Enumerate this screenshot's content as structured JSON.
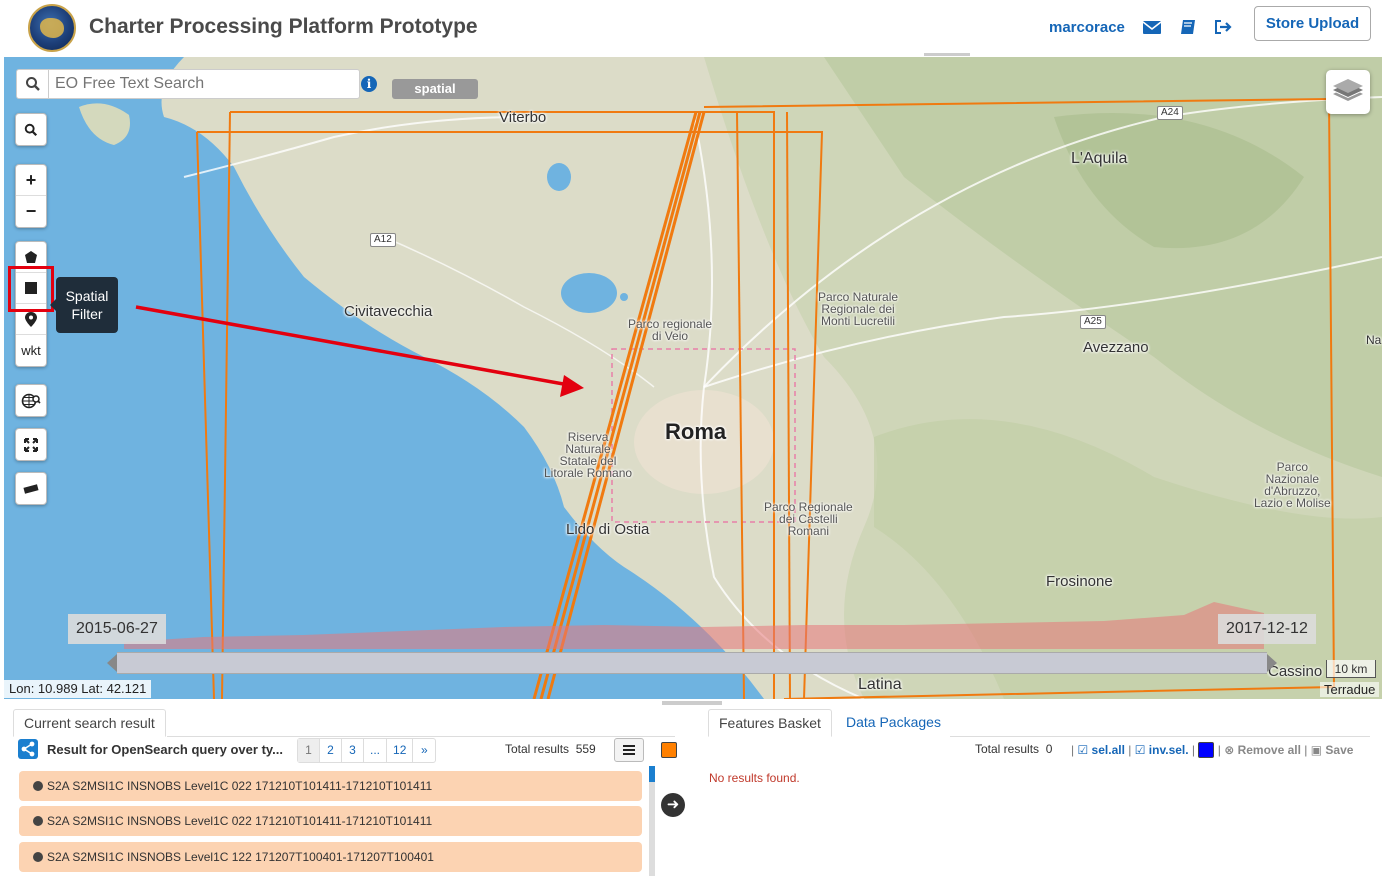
{
  "header": {
    "title": "Charter Processing Platform Prototype",
    "user": "marcorace",
    "store_upload": "Store Upload",
    "icons": [
      "envelope-icon",
      "book-icon",
      "sign-out-icon"
    ]
  },
  "map": {
    "search_placeholder": "EO Free Text Search",
    "mode_badge": "spatial",
    "tooltip": "Spatial Filter",
    "wkt_label": "wkt",
    "places": {
      "viterbo": "Viterbo",
      "civitavecchia": "Civitavecchia",
      "roma": "Roma",
      "laquila": "L'Aquila",
      "avezzano": "Avezzano",
      "frosinone": "Frosinone",
      "latina": "Latina",
      "cassino": "Cassino",
      "lido": "Lido di Ostia"
    },
    "parks": {
      "veio": "Parco regionale\ndi Veio",
      "lucretili": "Parco Naturale\nRegionale dei\nMonti Lucretili",
      "litorale": "Riserva\nNaturale\nStatale del\nLitorale Romano",
      "castelli": "Parco Regionale\ndei Castelli\nRomani",
      "abruzzo": "Parco\nNazionale\nd'Abruzzo,\nLazio e Molise"
    },
    "roads": {
      "a12": "A12",
      "a24": "A24",
      "a25": "A25"
    },
    "edge_label": "Na",
    "timeline": {
      "start": "2015-06-27",
      "end": "2017-12-12"
    },
    "coords": "Lon: 10.989 Lat: 42.121",
    "scale": "10 km",
    "attribution": "Terradue"
  },
  "results": {
    "tab_label": "Current search result",
    "title": "Result for OpenSearch query over ty...",
    "pages": [
      "1",
      "2",
      "3",
      "...",
      "12",
      "»"
    ],
    "total_label": "Total results",
    "total_value": "559",
    "swatch_color": "#ff8000",
    "rows": [
      "S2A S2MSI1C INSNOBS Level1C 022 171210T101411-171210T101411",
      "S2A S2MSI1C INSNOBS Level1C 022 171210T101411-171210T101411",
      "S2A S2MSI1C INSNOBS Level1C 122 171207T100401-171207T100401"
    ]
  },
  "basket": {
    "tab_active": "Features Basket",
    "tab_other": "Data Packages",
    "total_label": "Total results",
    "total_value": "0",
    "sel_all": "sel.all",
    "inv_sel": "inv.sel.",
    "remove_all": "Remove all",
    "save": "Save",
    "swatch_color": "#0000ff",
    "empty": "No results found."
  }
}
